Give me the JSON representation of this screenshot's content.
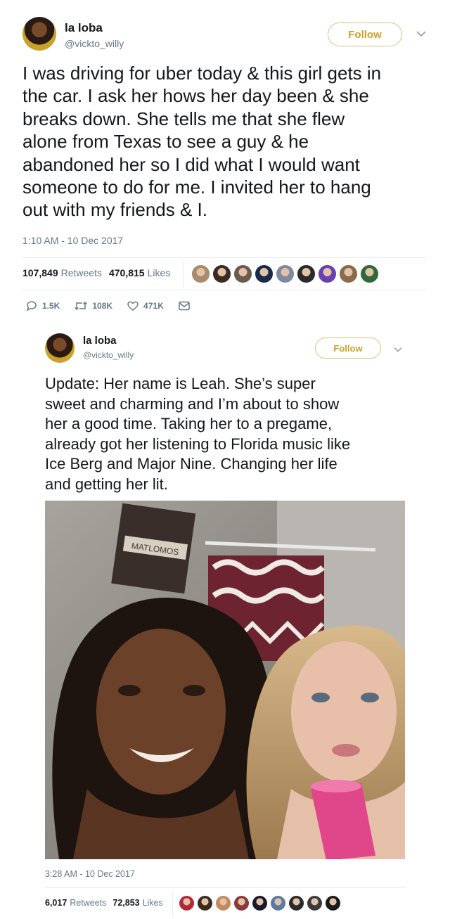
{
  "tweet1": {
    "name": "la loba",
    "handle": "@vickto_willy",
    "follow_label": "Follow",
    "lines": [
      "I was driving for uber today & this girl gets in",
      "the car. I ask her hows her day been & she",
      "breaks down. She tells me that she flew",
      "alone from Texas to see a guy & he",
      "abandoned her so I did what I would want",
      "someone to do for me. I invited her to hang",
      "out with my friends & I."
    ],
    "timestamp": "1:10 AM - 10 Dec 2017",
    "retweets_count": "107,849",
    "retweets_label": "Retweets",
    "likes_count": "470,815",
    "likes_label": "Likes",
    "reply_count": "1.5K",
    "retweet_action_count": "108K",
    "like_action_count": "471K"
  },
  "tweet2": {
    "name": "la loba",
    "handle": "@vickto_willy",
    "follow_label": "Follow",
    "lines": [
      "Update: Her name is Leah. She’s super",
      "sweet and charming and I’m about to show",
      "her a good time. Taking her to a pregame,",
      "already got her listening to Florida music like",
      "Ice Berg and Major Nine. Changing her life",
      "and getting her lit."
    ],
    "timestamp": "3:28 AM - 10 Dec 2017",
    "retweets_count": "6,017",
    "retweets_label": "Retweets",
    "likes_count": "72,853",
    "likes_label": "Likes"
  },
  "photo": {
    "sign_text": "MATLOMOS",
    "icon": "selfie-photo"
  },
  "colors": {
    "follow_gold": "#c9a227",
    "gray_text": "#657786",
    "divider": "#e6ecf0"
  },
  "face_colors1": [
    "#a98a6a",
    "#3d2b22",
    "#6b5a4e",
    "#1b2a4a",
    "#7e8aa0",
    "#2b2b2b",
    "#6a3fb0",
    "#8a6a4a",
    "#2f6b3a"
  ],
  "face_colors2": [
    "#b02a3a",
    "#3a2a20",
    "#c08a5a",
    "#8a3a3a",
    "#1a1a2a",
    "#5a7aa0",
    "#2a2a2a",
    "#3a3a3a",
    "#1a1a1a"
  ]
}
